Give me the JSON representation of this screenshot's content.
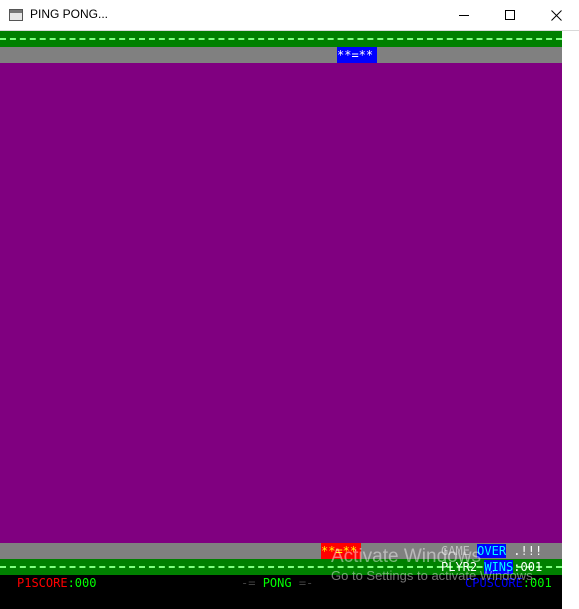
{
  "window": {
    "title": "PING PONG...",
    "icon": "console-window-icon",
    "controls": [
      "minimize-icon",
      "maximize-icon",
      "close-icon"
    ]
  },
  "game": {
    "top_paddle": "**=**",
    "bottom_paddle": "**=**",
    "status": {
      "game_word": "GAME",
      "over_word": "OVER",
      "exclaim": ".!!!",
      "winner": "PLYR2",
      "wins_word": "WINS",
      "wins_value": ":001"
    },
    "scorebar": {
      "p1_label": "P1SCORE",
      "p1_value": ":000",
      "pong_left": "-=",
      "pong_word": "PONG",
      "pong_right": "=-",
      "cpu_label": "CPUSCORE",
      "cpu_value": ":001"
    }
  },
  "watermark": {
    "line1": "Activate Windows",
    "line2": "Go to Settings to activate Windows."
  },
  "colors": {
    "court": "#800080",
    "border_green": "#008000",
    "border_grey": "#808080",
    "top_paddle": "#0000ff",
    "bottom_paddle": "#ff0000"
  }
}
